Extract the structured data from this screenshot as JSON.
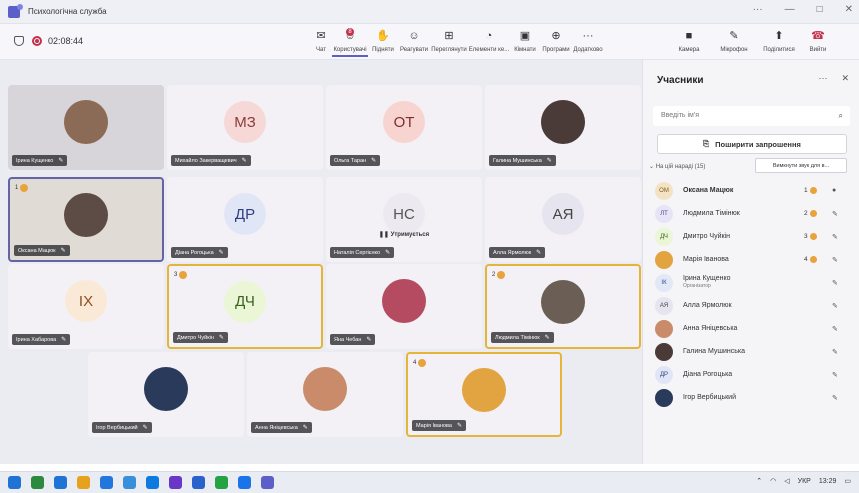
{
  "window": {
    "title": "Психологічна служба",
    "controls": [
      "···",
      "—",
      "□",
      "✕"
    ]
  },
  "toolbar": {
    "timer": "02:08:44",
    "items": [
      {
        "label": "Чат",
        "icon": "chat-icon",
        "glyph": "✉"
      },
      {
        "label": "Користувачі",
        "icon": "people-icon",
        "glyph": "☺",
        "badge": "8"
      },
      {
        "label": "Підняти",
        "icon": "raise-hand-icon",
        "glyph": "✋"
      },
      {
        "label": "Реагувати",
        "icon": "react-icon",
        "glyph": "☺"
      },
      {
        "label": "Переглянути",
        "icon": "view-icon",
        "glyph": "⊞"
      },
      {
        "label": "Елементи ке...",
        "icon": "controls-icon",
        "glyph": "◔"
      },
      {
        "label": "Кімнати",
        "icon": "rooms-icon",
        "glyph": "▣"
      },
      {
        "label": "Програми",
        "icon": "apps-icon",
        "glyph": "⊕"
      },
      {
        "label": "Додатково",
        "icon": "more-icon",
        "glyph": "···"
      }
    ],
    "right_items": [
      {
        "label": "Камера",
        "icon": "camera-icon",
        "glyph": "■"
      },
      {
        "label": "Мікрофон",
        "icon": "mic-icon",
        "glyph": "✎"
      },
      {
        "label": "Поділитися",
        "icon": "share-icon",
        "glyph": "⬆"
      },
      {
        "label": "Вийти",
        "icon": "leave-icon",
        "glyph": "☎"
      }
    ]
  },
  "tiles": [
    {
      "name": "Ірина Кущенко",
      "initials": "",
      "bg": "#d7d4da",
      "photo": true,
      "photo_color": "#8b6b55"
    },
    {
      "name": "Михайло Закерващевич",
      "initials": "МЗ",
      "av_bg": "#f6d8d6",
      "av_color": "#8a3b3b"
    },
    {
      "name": "Ольга Таран",
      "initials": "ОТ",
      "av_bg": "#f8d4d0",
      "av_color": "#7c2e2e"
    },
    {
      "name": "Галина Мушинська",
      "initials": "",
      "photo": true,
      "photo_color": "#4a3a38"
    },
    {
      "name": "Оксана Мацюк",
      "initials": "",
      "bg": "#e0dcd5",
      "photo": true,
      "photo_color": "#5c4c45",
      "hand": "1"
    },
    {
      "name": "Діана Рогоцька",
      "initials": "ДР",
      "av_bg": "#e1e6f7",
      "av_color": "#2f3f80"
    },
    {
      "name": "Наталія Сергієнко",
      "initials": "НС",
      "av_bg": "#ede9f1",
      "av_color": "#555",
      "status": "Утримується"
    },
    {
      "name": "Алла Ярмолюк",
      "initials": "АЯ",
      "av_bg": "#e6e4ee",
      "av_color": "#444"
    },
    {
      "name": "Ірина Хабарова",
      "initials": "ІХ",
      "av_bg": "#fbe9d8",
      "av_color": "#8a4f20"
    },
    {
      "name": "Дмитро Чуйкін",
      "initials": "ДЧ",
      "av_bg": "#eaf6d6",
      "av_color": "#3c6320",
      "hand": "3"
    },
    {
      "name": "Яна Чебан",
      "initials": "",
      "photo": true,
      "photo_color": "#b44b60"
    },
    {
      "name": "Людмила Тімінюк",
      "initials": "",
      "photo": true,
      "photo_color": "#6b5f55",
      "hand": "2"
    },
    {
      "name": "Ігор Вербицький",
      "initials": "",
      "photo": true,
      "photo_color": "#2a3a5a"
    },
    {
      "name": "Анна Яніцевська",
      "initials": "",
      "photo": true,
      "photo_color": "#c98b6a"
    },
    {
      "name": "Марія Іванова",
      "initials": "",
      "photo": true,
      "photo_color": "#e2a440",
      "hand": "4"
    }
  ],
  "panel": {
    "title": "Учасники",
    "search_placeholder": "Введіть ім'я",
    "share_label": "Поширити запрошення",
    "section": "На цій нараді (15)",
    "mute_all": "Вимкнути звук для в...",
    "participants": [
      {
        "name": "Оксана Мацюк",
        "initials": "ОМ",
        "av_bg": "#f3e3c4",
        "av_color": "#7a5a1d",
        "hand": "1",
        "bold": true,
        "mic": "on"
      },
      {
        "name": "Людмила Тімінюк",
        "initials": "ЛТ",
        "av_bg": "#e7e4f5",
        "av_color": "#4b4490",
        "hand": "2"
      },
      {
        "name": "Дмитро Чуйкін",
        "initials": "ДЧ",
        "av_bg": "#eaf6d6",
        "av_color": "#3c6320",
        "hand": "3"
      },
      {
        "name": "Марія Іванова",
        "initials": "",
        "av_bg": "#e2a440",
        "av_color": "#fff",
        "hand": "4"
      },
      {
        "name": "Ірина Кущенко",
        "initials": "ІК",
        "av_bg": "#e3e8f6",
        "av_color": "#34479a",
        "sub": "Організатор"
      },
      {
        "name": "Алла Ярмолюк",
        "initials": "АЯ",
        "av_bg": "#e6e4ee",
        "av_color": "#444"
      },
      {
        "name": "Анна Яніцевська",
        "initials": "",
        "av_bg": "#c98b6a",
        "av_color": "#fff"
      },
      {
        "name": "Галина Мушинська",
        "initials": "",
        "av_bg": "#4a3a38",
        "av_color": "#fff"
      },
      {
        "name": "Діана Рогоцька",
        "initials": "ДР",
        "av_bg": "#e1e6f7",
        "av_color": "#2f3f80"
      },
      {
        "name": "Ігор Вербицький",
        "initials": "",
        "av_bg": "#2a3a5a",
        "av_color": "#fff"
      }
    ]
  },
  "taskbar": {
    "lang": "УКР",
    "time": "13:29",
    "icon_colors": [
      "#1e73d4",
      "#2b8a3e",
      "#1e73d4",
      "#e6a21e",
      "#2277dd",
      "#3a8fdb",
      "#0d7adf",
      "#6a36c7",
      "#2a62cc",
      "#25a244",
      "#1a73e8",
      "#5b5fc7"
    ]
  }
}
